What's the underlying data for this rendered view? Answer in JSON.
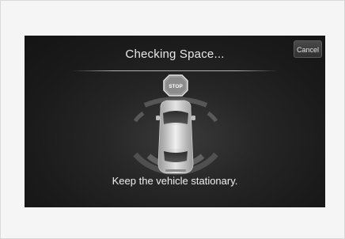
{
  "screen": {
    "title": "Checking Space...",
    "cancel_label": "Cancel",
    "stop_sign_text": "STOP",
    "message": "Keep the vehicle stationary."
  },
  "icons": {
    "stop": "stop-sign-icon",
    "vehicle": "car-topview-icon"
  },
  "colors": {
    "screen_bg": "#1a1a1a",
    "text": "#e8e8e8",
    "stop_sign": "#888888"
  }
}
